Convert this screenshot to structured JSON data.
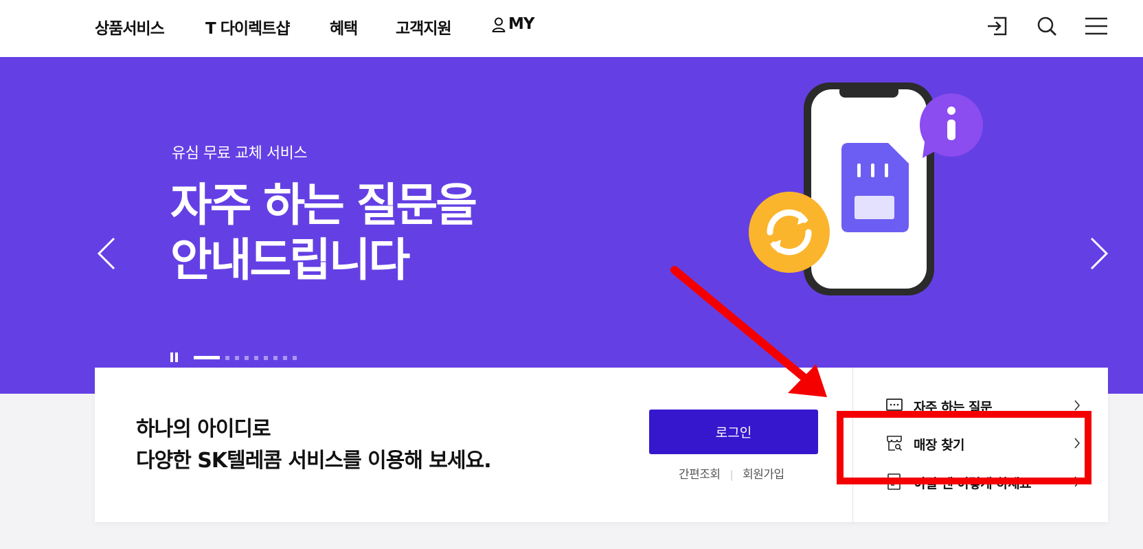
{
  "header": {
    "nav": [
      {
        "label": "상품서비스"
      },
      {
        "label": "T 다이렉트샵"
      },
      {
        "label": "혜택"
      },
      {
        "label": "고객지원"
      },
      {
        "label": "MY"
      }
    ],
    "icons": [
      "login-icon",
      "search-icon",
      "menu-icon"
    ]
  },
  "hero": {
    "subtitle": "유심 무료 교체 서비스",
    "title_line1": "자주 하는 질문을",
    "title_line2": "안내드립니다",
    "slide_count": 9,
    "active_slide": 1,
    "colors": {
      "background": "#6440e4",
      "badge_orange": "#fbb52c",
      "info_purple": "#8b4cf0"
    }
  },
  "login_card": {
    "line1": "하나의 아이디로",
    "line2": "다양한 SK텔레콤 서비스를 이용해 보세요.",
    "login_label": "로그인",
    "quick_lookup": "간편조회",
    "sign_up": "회원가입",
    "button_color": "#3617ce"
  },
  "quick_links": [
    {
      "label": "자주 하는 질문",
      "icon": "faq-icon"
    },
    {
      "label": "매장 찾기",
      "icon": "store-icon"
    },
    {
      "label": "이럴 땐 이렇게 하세요",
      "icon": "guide-icon"
    }
  ],
  "annotation": {
    "color": "#f40000",
    "highlight_target": "매장 찾기"
  }
}
